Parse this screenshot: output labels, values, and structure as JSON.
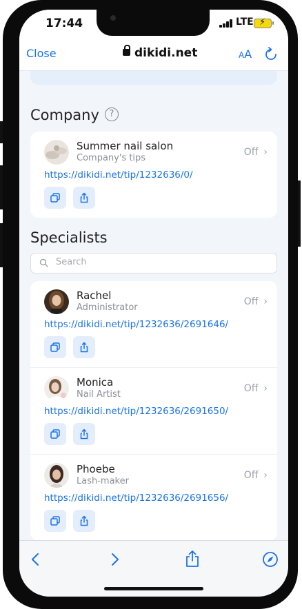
{
  "status_bar": {
    "time": "17:44",
    "network": "LTE"
  },
  "browser": {
    "close_label": "Close",
    "url": "dikidi.net",
    "text_size_small": "A",
    "text_size_large": "A"
  },
  "company": {
    "heading": "Company",
    "help_icon": "?",
    "item": {
      "name": "Summer nail salon",
      "role": "Company's tips",
      "status": "Off",
      "link": "https://dikidi.net/tip/1232636/0/"
    }
  },
  "specialists": {
    "heading": "Specialists",
    "search_placeholder": "Search",
    "items": [
      {
        "name": "Rachel",
        "role": "Administrator",
        "status": "Off",
        "link": "https://dikidi.net/tip/1232636/2691646/"
      },
      {
        "name": "Monica",
        "role": "Nail Artist",
        "status": "Off",
        "link": "https://dikidi.net/tip/1232636/2691650/"
      },
      {
        "name": "Phoebe",
        "role": "Lash-maker",
        "status": "Off",
        "link": "https://dikidi.net/tip/1232636/2691656/"
      }
    ]
  },
  "icons": {
    "copy": "copy-icon",
    "share": "share-icon",
    "back": "back-arrow-icon",
    "forward": "forward-arrow-icon",
    "compass": "compass-icon",
    "reload": "reload-icon",
    "lock": "lock-icon",
    "search": "search-icon",
    "chevron": "chevron-right-icon"
  },
  "colors": {
    "accent": "#1a73e8",
    "button_bg": "#e3edfb",
    "page_bg": "#f2f5fa"
  }
}
